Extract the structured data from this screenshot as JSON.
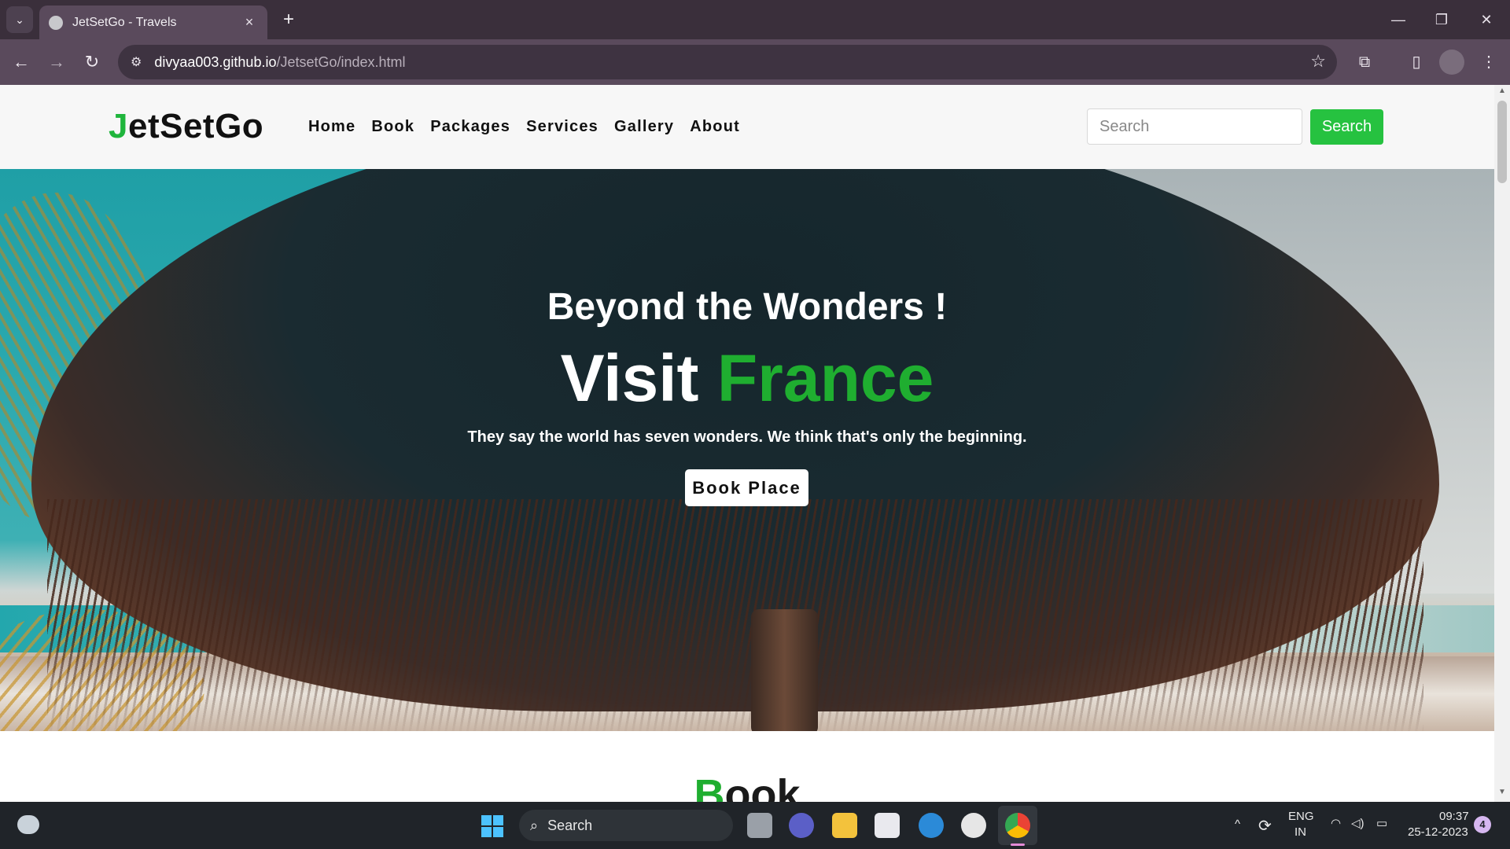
{
  "browser": {
    "tab_title": "JetSetGo - Travels",
    "tab_close_icon": "×",
    "new_tab_icon": "+",
    "window_controls": {
      "minimize": "—",
      "restore": "❐",
      "close": "✕"
    },
    "url_host": "divyaa003.github.io",
    "url_path": "/JetsetGo/index.html",
    "nav": {
      "back": "←",
      "forward": "→",
      "reload": "↻"
    },
    "site_info_icon": "⚙",
    "bookmark_icon": "☆",
    "extensions_icon": "⧉",
    "sidepanel_icon": "▯",
    "menu_icon": "⋮"
  },
  "site": {
    "logo_first": "J",
    "logo_rest": "etSetGo",
    "menu": [
      "Home",
      "Book",
      "Packages",
      "Services",
      "Gallery",
      "About"
    ],
    "search_placeholder": "Search",
    "search_button": "Search"
  },
  "hero": {
    "subtitle": "Beyond the Wonders !",
    "title_plain": "Visit ",
    "title_accent": "France",
    "tagline": "They say the world has seven wonders. We think that's only the beginning.",
    "cta": "Book Place"
  },
  "next_section": {
    "heading_first": "B",
    "heading_rest": "ook"
  },
  "taskbar": {
    "search_label": "Search",
    "search_icon": "⌕",
    "lang_top": "ENG",
    "lang_bottom": "IN",
    "time": "09:37",
    "date": "25-12-2023",
    "notification_count": "4",
    "chevron_icon": "^",
    "wifi_icon": "◠",
    "volume_icon": "◁)",
    "battery_icon": "▭"
  },
  "colors": {
    "accent_green": "#1fae30",
    "search_green": "#26c240",
    "chrome_frame": "#3a2f3b",
    "chrome_toolbar": "#5a4a5c",
    "taskbar": "#202429"
  }
}
